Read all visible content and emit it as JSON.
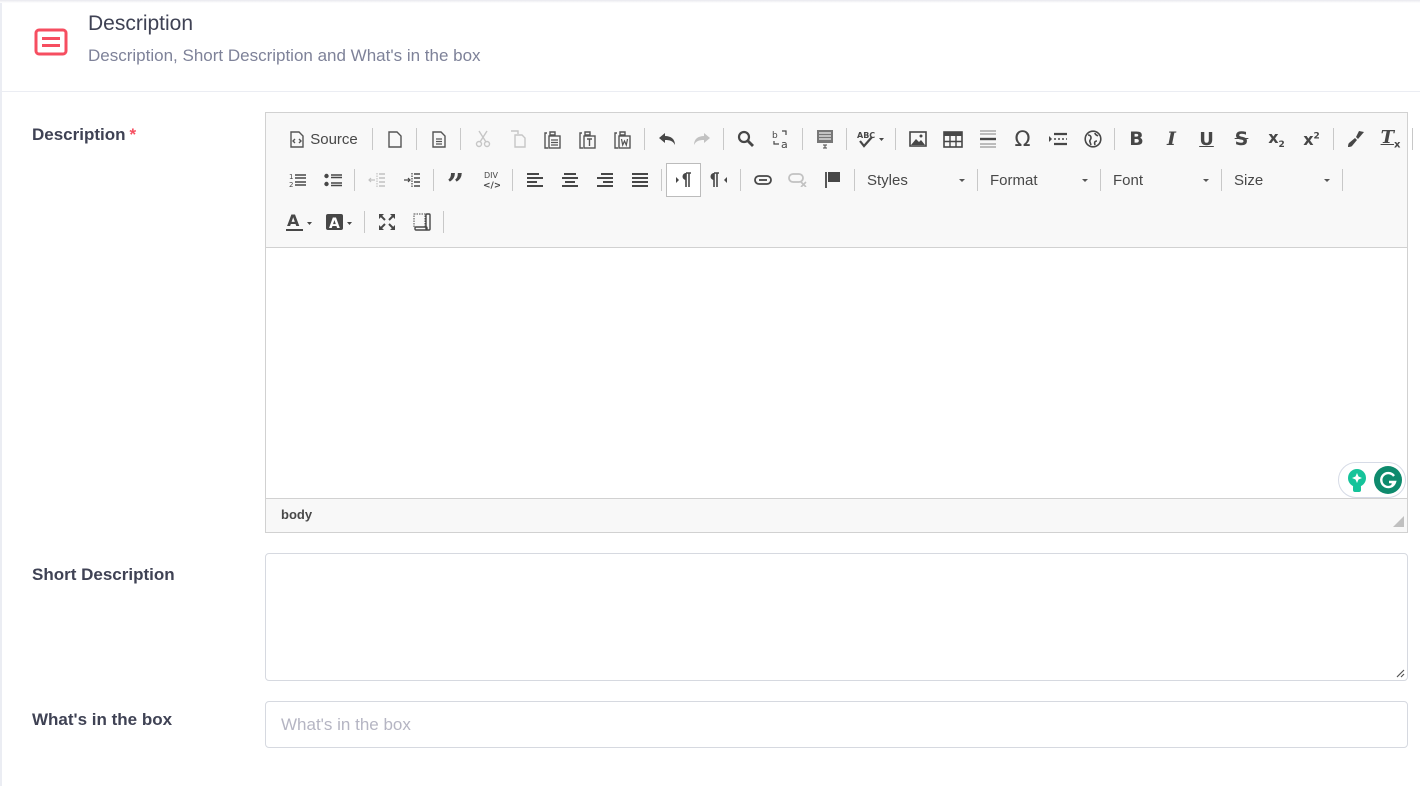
{
  "header": {
    "title": "Description",
    "subtitle": "Description, Short Description and What's in the box",
    "icon": "description-icon",
    "icon_color": "#f64e60"
  },
  "fields": {
    "description": {
      "label": "Description",
      "required_mark": "*",
      "editor": {
        "toolbar_row1": [
          {
            "name": "source",
            "label": "Source",
            "icon": "source-icon"
          },
          {
            "name": "new-page",
            "icon": "new-page-icon"
          },
          {
            "name": "preview",
            "icon": "preview-icon"
          },
          {
            "name": "cut",
            "icon": "cut-icon",
            "disabled": true
          },
          {
            "name": "copy",
            "icon": "copy-icon",
            "disabled": true
          },
          {
            "name": "paste",
            "icon": "paste-icon"
          },
          {
            "name": "paste-text",
            "icon": "paste-text-icon"
          },
          {
            "name": "paste-word",
            "icon": "paste-word-icon"
          },
          {
            "name": "undo",
            "icon": "undo-icon"
          },
          {
            "name": "redo",
            "icon": "redo-icon",
            "disabled": true
          },
          {
            "name": "find",
            "icon": "find-icon"
          },
          {
            "name": "replace",
            "icon": "replace-icon"
          },
          {
            "name": "select-all",
            "icon": "select-all-icon"
          },
          {
            "name": "spellcheck",
            "icon": "spellcheck-icon"
          },
          {
            "name": "image",
            "icon": "image-icon"
          },
          {
            "name": "table",
            "icon": "table-icon"
          },
          {
            "name": "horizontal-rule",
            "icon": "horizontal-rule-icon"
          },
          {
            "name": "special-char",
            "icon": "omega-icon"
          },
          {
            "name": "page-break",
            "icon": "page-break-icon"
          },
          {
            "name": "iframe",
            "icon": "globe-icon"
          },
          {
            "name": "bold",
            "icon": "bold-icon"
          },
          {
            "name": "italic",
            "icon": "italic-icon"
          },
          {
            "name": "underline",
            "icon": "underline-icon"
          },
          {
            "name": "strike",
            "icon": "strikethrough-icon"
          },
          {
            "name": "subscript",
            "icon": "subscript-icon"
          },
          {
            "name": "superscript",
            "icon": "superscript-icon"
          },
          {
            "name": "copy-format",
            "icon": "paintbrush-icon"
          },
          {
            "name": "remove-format",
            "icon": "remove-format-icon"
          }
        ],
        "combos": {
          "styles": "Styles",
          "format": "Format",
          "font": "Font",
          "size": "Size"
        },
        "path": "body"
      }
    },
    "short_description": {
      "label": "Short Description",
      "value": ""
    },
    "whats_in_box": {
      "label": "What's in the box",
      "value": "",
      "placeholder": "What's in the box"
    }
  }
}
